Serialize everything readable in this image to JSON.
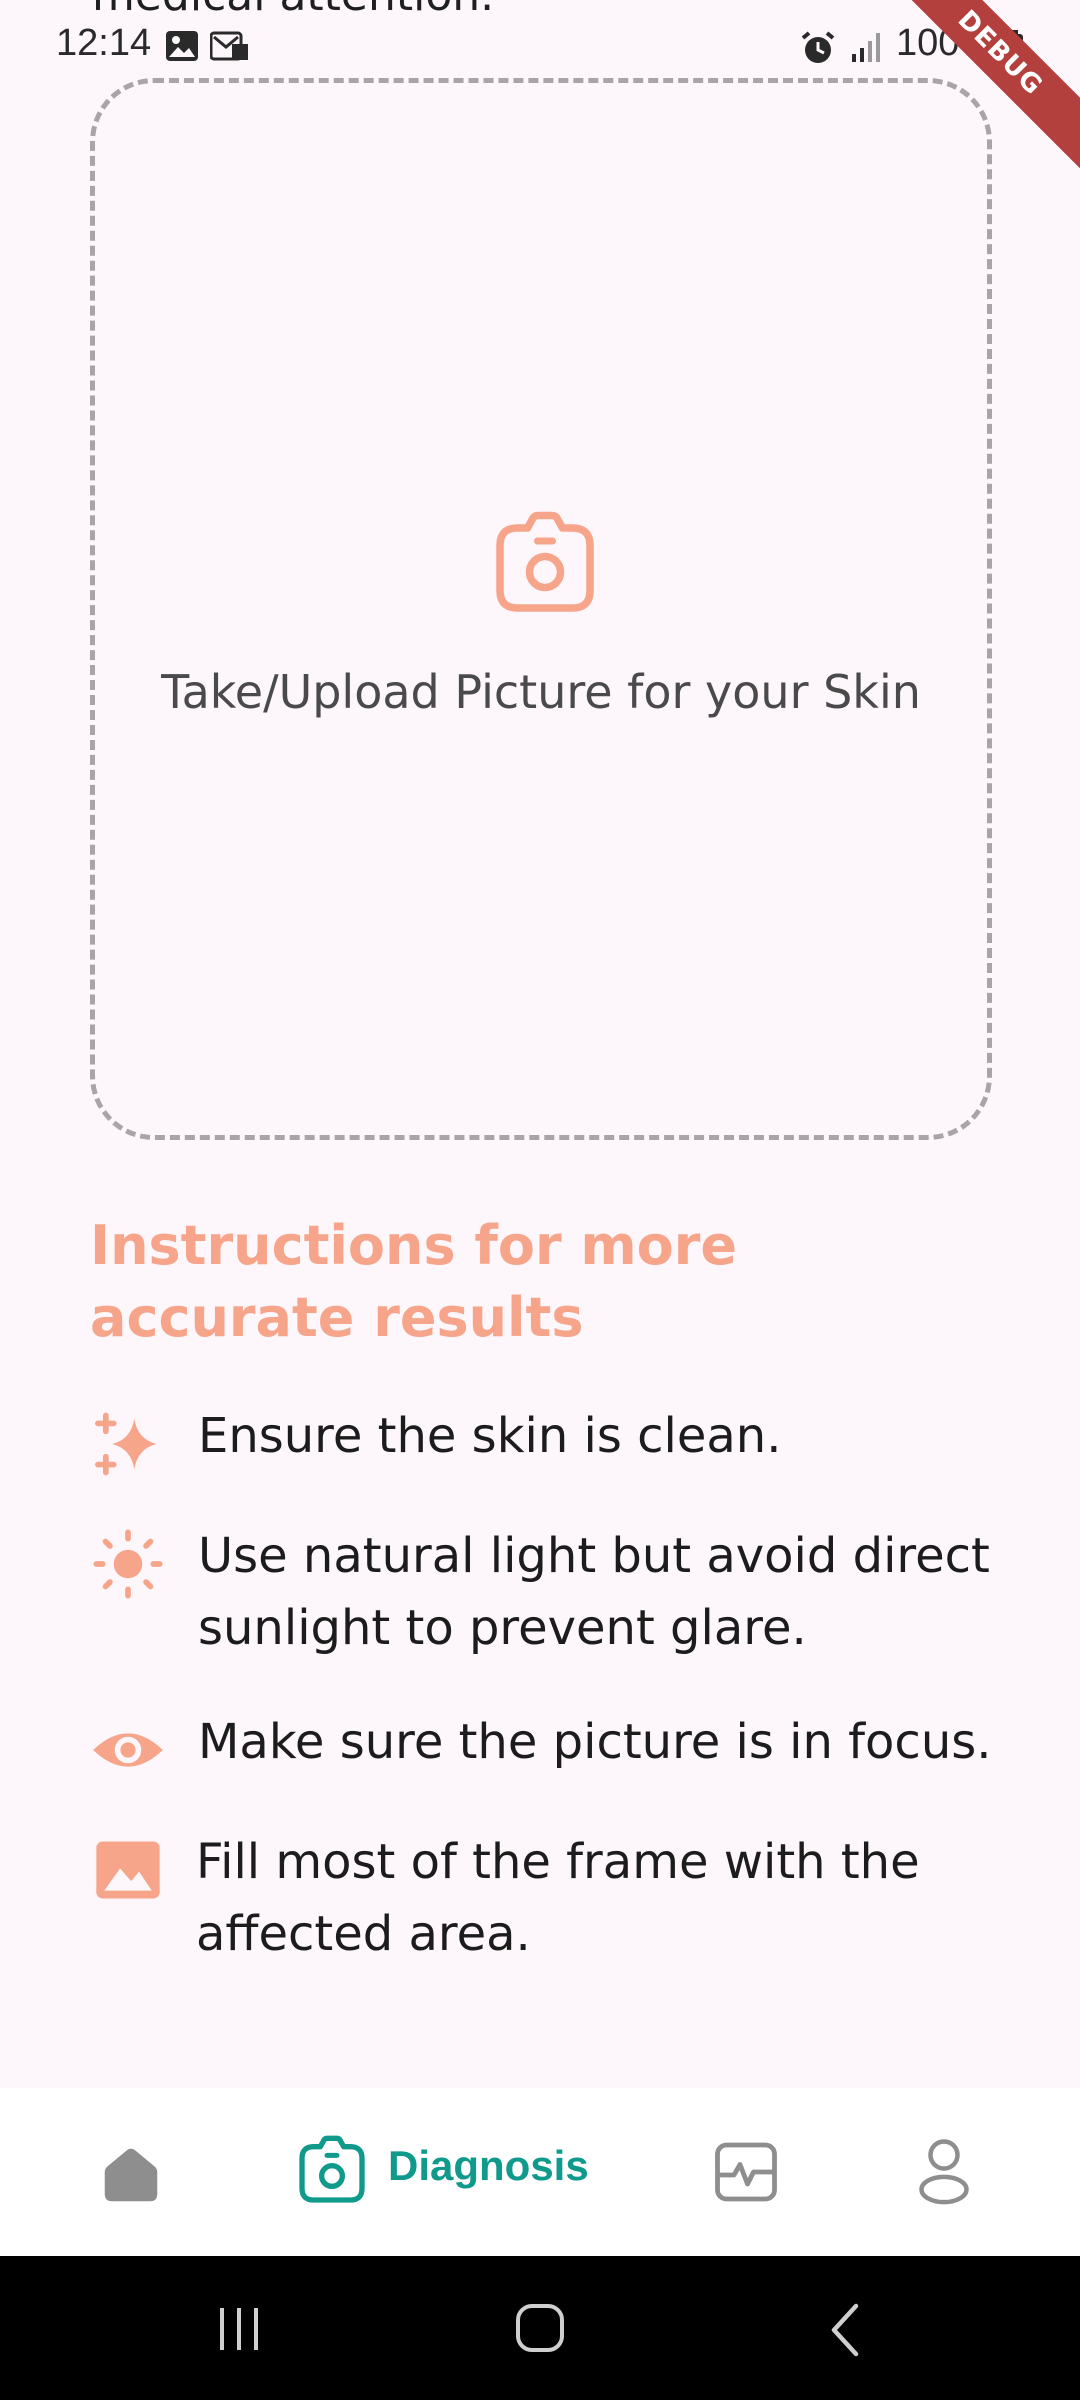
{
  "scrolled_text": "medical attention.",
  "status_bar": {
    "time": "12:14",
    "battery": "100%",
    "debug_banner": "DEBUG"
  },
  "upload": {
    "label": "Take/Upload Picture for your Skin",
    "icon": "camera-icon"
  },
  "instructions": {
    "title": "Instructions for more accurate results",
    "items": [
      {
        "icon": "sparkle-icon",
        "text": "Ensure the skin is clean."
      },
      {
        "icon": "sun-icon",
        "text": "Use natural light but avoid direct sunlight to prevent glare."
      },
      {
        "icon": "eye-icon",
        "text": "Make sure the picture is in focus."
      },
      {
        "icon": "image-icon",
        "text": "Fill most of the frame with the affected area."
      }
    ]
  },
  "bottom_nav": {
    "items": [
      {
        "icon": "home-icon",
        "label": "",
        "active": false
      },
      {
        "icon": "camera-icon",
        "label": "Diagnosis",
        "active": true
      },
      {
        "icon": "pulse-chart-icon",
        "label": "",
        "active": false
      },
      {
        "icon": "profile-icon",
        "label": "",
        "active": false
      }
    ]
  },
  "colors": {
    "accent_peach": "#f6a58a",
    "active_teal": "#0f9a8c",
    "background": "#fdf6fb",
    "inactive_icon": "#8e8e8e"
  }
}
